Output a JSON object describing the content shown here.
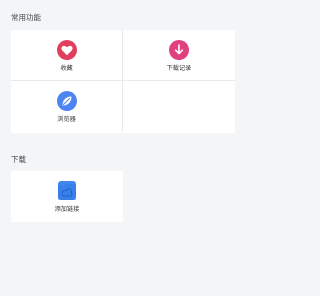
{
  "sections": {
    "common": {
      "title": "常用功能",
      "tiles": [
        {
          "label": "收藏",
          "icon": "heart-icon",
          "color": "#e0405e"
        },
        {
          "label": "下载记录",
          "icon": "download-arrow-icon",
          "color": "#e0407e"
        },
        {
          "label": "浏览器",
          "icon": "leaf-icon",
          "color": "#4e84ef"
        }
      ]
    },
    "download": {
      "title": "下载",
      "tiles": [
        {
          "label": "添加链接",
          "icon": "add-link-icon",
          "color": "#3f86f0"
        }
      ]
    }
  }
}
